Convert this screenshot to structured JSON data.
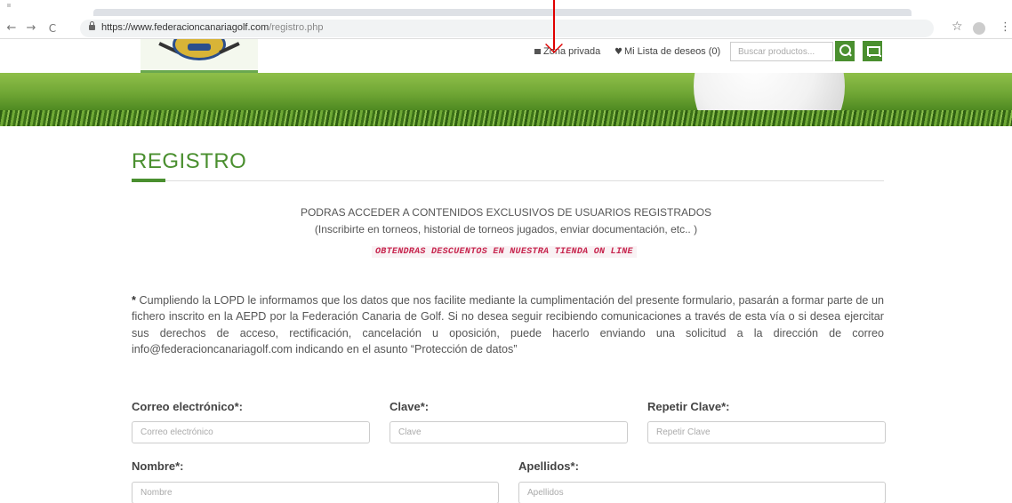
{
  "browser": {
    "url_domain": "https://www.federacioncanariagolf.com",
    "url_path": "/registro.php",
    "back": "←",
    "forward": "→",
    "reload": "C",
    "star": "☆",
    "menu": "⋮"
  },
  "header": {
    "zona_label": "Zona privada",
    "wishlist_label": "Mi Lista de deseos (0)",
    "search_placeholder": "Buscar productos..."
  },
  "main": {
    "title": "REGISTRO",
    "intro_line1": "PODRAS ACCEDER A CONTENIDOS EXCLUSIVOS DE USUARIOS REGISTRADOS",
    "intro_line2": "(Inscribirte en torneos, historial de torneos jugados, enviar documentación, etc.. )",
    "promo": "OBTENDRAS DESCUENTOS EN NUESTRA TIENDA ON LINE",
    "lopd_star": "*",
    "lopd_text": " Cumpliendo la LOPD le informamos que los datos que nos facilite mediante la cumplimentación del presente formulario, pasarán a formar parte de un fichero inscrito en la AEPD por la Federación Canaria de Golf. Si no desea seguir recibiendo comunicaciones a través de esta vía o si desea ejercitar sus derechos de acceso, rectificación, cancelación u oposición, puede hacerlo enviando una solicitud a la dirección de correo info@federacioncanariagolf.com indicando en el asunto “Protección de datos”"
  },
  "form": {
    "email_label": "Correo electrónico*:",
    "email_placeholder": "Correo electrónico",
    "password_label": "Clave*:",
    "password_placeholder": "Clave",
    "repeat_label": "Repetir Clave*:",
    "repeat_placeholder": "Repetir Clave",
    "name_label": "Nombre*:",
    "name_placeholder": "Nombre",
    "surname_label": "Apellidos*:",
    "surname_placeholder": "Apellidos"
  },
  "colors": {
    "accent_green": "#4a8f2f",
    "promo_red": "#c7254e",
    "annotation_arrow": "#e00000"
  }
}
